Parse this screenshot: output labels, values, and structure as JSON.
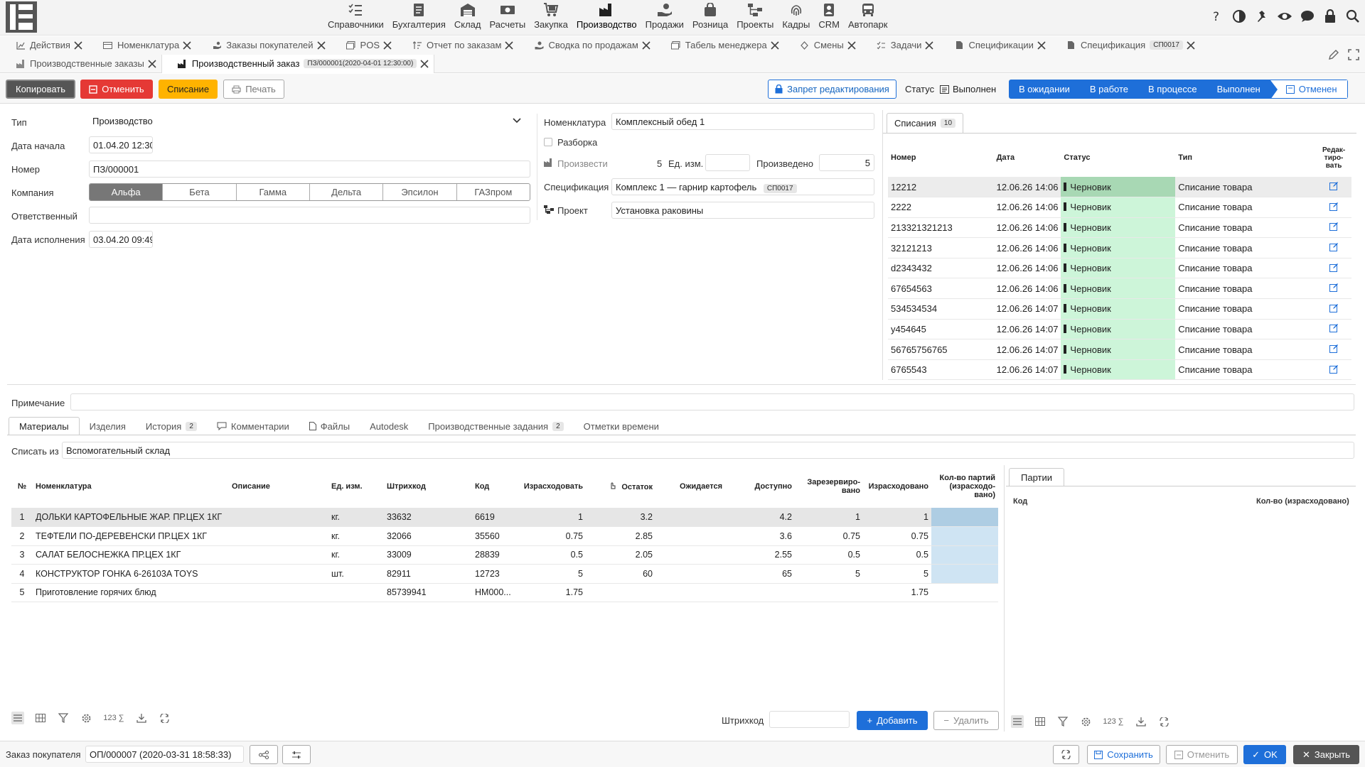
{
  "nav": {
    "modules": [
      {
        "label": "Справочники",
        "icon": "list-icon"
      },
      {
        "label": "Бухгалтерия",
        "icon": "ledger-icon"
      },
      {
        "label": "Склад",
        "icon": "warehouse-icon"
      },
      {
        "label": "Расчеты",
        "icon": "money-icon"
      },
      {
        "label": "Закупка",
        "icon": "cart-icon"
      },
      {
        "label": "Производство",
        "icon": "factory-icon"
      },
      {
        "label": "Продажи",
        "icon": "hand-coin-icon"
      },
      {
        "label": "Розница",
        "icon": "bag-icon"
      },
      {
        "label": "Проекты",
        "icon": "sitemap-icon"
      },
      {
        "label": "Кадры",
        "icon": "fingerprint-icon"
      },
      {
        "label": "CRM",
        "icon": "contact-icon"
      },
      {
        "label": "Автопарк",
        "icon": "bus-icon"
      }
    ]
  },
  "tabs": {
    "row1": [
      {
        "label": "Действия"
      },
      {
        "label": "Номенклатура"
      },
      {
        "label": "Заказы покупателей"
      },
      {
        "label": "POS"
      },
      {
        "label": "Отчет по заказам"
      },
      {
        "label": "Сводка по продажам"
      },
      {
        "label": "Табель менеджера"
      },
      {
        "label": "Смены"
      },
      {
        "label": "Задачи"
      },
      {
        "label": "Спецификации"
      },
      {
        "label": "Спецификация",
        "badge": "СП0017"
      }
    ],
    "row2": [
      {
        "label": "Производственные заказы"
      },
      {
        "label": "Производственный заказ",
        "badge": "ПЗ/000001(2020-04-01 12:30:00)"
      }
    ]
  },
  "toolbar": {
    "copy": "Копировать",
    "cancel": "Отменить",
    "writeoff": "Списание",
    "print": "Печать",
    "lock": "Запрет редактирования",
    "status_label": "Статус",
    "status_value": "Выполнен",
    "steps": [
      "В ожидании",
      "В работе",
      "В процессе",
      "Выполнен",
      "Отменен"
    ]
  },
  "form": {
    "type_label": "Тип",
    "type_value": "Производство",
    "start_label": "Дата начала",
    "start_value": "01.04.20 12:30",
    "number_label": "Номер",
    "number_value": "ПЗ/000001",
    "company_label": "Компания",
    "companies": [
      "Альфа",
      "Бета",
      "Гамма",
      "Дельта",
      "Эпсилон",
      "ГАЗпром"
    ],
    "responsible_label": "Ответственный",
    "responsible_value": "",
    "exec_label": "Дата исполнения",
    "exec_value": "03.04.20 09:49",
    "nomen_label": "Номенклатура",
    "nomen_value": "Комплексный обед 1",
    "disassembly_label": "Разборка",
    "produce_label": "Произвести",
    "produce_qty": "5",
    "unit_label": "Ед. изм.",
    "unit_value": "",
    "produced_label": "Произведено",
    "produced_value": "5",
    "spec_label": "Спецификация",
    "spec_value": "Комплекс 1 — гарнир картофель",
    "spec_badge": "СП0017",
    "project_label": "Проект",
    "project_value": "Установка раковины",
    "note_label": "Примечание",
    "note_value": ""
  },
  "writeoffs": {
    "tab_label": "Списания",
    "count": "10",
    "headers": [
      "Номер",
      "Дата",
      "Статус",
      "Тип",
      "Редак-тиро-вать"
    ],
    "rows": [
      {
        "num": "12212",
        "date": "12.06.26 14:06",
        "status": "Черновик",
        "type": "Списание товара"
      },
      {
        "num": "2222",
        "date": "12.06.26 14:06",
        "status": "Черновик",
        "type": "Списание товара"
      },
      {
        "num": "213321321213",
        "date": "12.06.26 14:06",
        "status": "Черновик",
        "type": "Списание товара"
      },
      {
        "num": "32121213",
        "date": "12.06.26 14:06",
        "status": "Черновик",
        "type": "Списание товара"
      },
      {
        "num": "d2343432",
        "date": "12.06.26 14:06",
        "status": "Черновик",
        "type": "Списание товара"
      },
      {
        "num": "67654563",
        "date": "12.06.26 14:06",
        "status": "Черновик",
        "type": "Списание товара"
      },
      {
        "num": "534534534",
        "date": "12.06.26 14:07",
        "status": "Черновик",
        "type": "Списание товара"
      },
      {
        "num": "y454645",
        "date": "12.06.26 14:07",
        "status": "Черновик",
        "type": "Списание товара"
      },
      {
        "num": "56765756765",
        "date": "12.06.26 14:07",
        "status": "Черновик",
        "type": "Списание товара"
      },
      {
        "num": "6765543",
        "date": "12.06.26 14:07",
        "status": "Черновик",
        "type": "Списание товара"
      }
    ]
  },
  "bottom_tabs": [
    {
      "label": "Материалы"
    },
    {
      "label": "Изделия"
    },
    {
      "label": "История",
      "badge": "2"
    },
    {
      "label": "Комментарии"
    },
    {
      "label": "Файлы"
    },
    {
      "label": "Autodesk"
    },
    {
      "label": "Производственные задания",
      "badge": "2"
    },
    {
      "label": "Отметки времени"
    }
  ],
  "materials": {
    "source_label": "Списать из",
    "source_value": "Вспомогательный склад",
    "headers": [
      "№",
      "Номенклатура",
      "Описание",
      "Ед. изм.",
      "Штрихкод",
      "Код",
      "Израсходовать",
      "Остаток",
      "Ожидается",
      "Доступно",
      "Зарезервиро-вано",
      "Израсходовано",
      "Кол-во партий (израсходо-вано)"
    ],
    "rows": [
      {
        "n": "1",
        "name": "ДОЛЬКИ КАРТОФЕЛЬНЫЕ ЖАР. ПР.ЦЕХ 1КГ",
        "desc": "",
        "unit": "кг.",
        "barcode": "33632",
        "code": "6619",
        "use": "1",
        "rest": "3.2",
        "expected": "",
        "avail": "4.2",
        "reserved": "1",
        "used": "1"
      },
      {
        "n": "2",
        "name": "ТЕФТЕЛИ ПО-ДЕРЕВЕНСКИ ПР.ЦЕХ 1КГ",
        "desc": "",
        "unit": "кг.",
        "barcode": "32066",
        "code": "35560",
        "use": "0.75",
        "rest": "2.85",
        "expected": "",
        "avail": "3.6",
        "reserved": "0.75",
        "used": "0.75"
      },
      {
        "n": "3",
        "name": "САЛАТ БЕЛОСНЕЖКА ПР.ЦЕХ 1КГ",
        "desc": "",
        "unit": "кг.",
        "barcode": "33009",
        "code": "28839",
        "use": "0.5",
        "rest": "2.05",
        "expected": "",
        "avail": "2.55",
        "reserved": "0.5",
        "used": "0.5"
      },
      {
        "n": "4",
        "name": "КОНСТРУКТОР ГОНКА 6-26103A TOYS",
        "desc": "",
        "unit": "шт.",
        "barcode": "82911",
        "code": "12723",
        "use": "5",
        "rest": "60",
        "expected": "",
        "avail": "65",
        "reserved": "5",
        "used": "5"
      },
      {
        "n": "5",
        "name": "Приготовление горячих блюд",
        "desc": "",
        "unit": "",
        "barcode": "85739941",
        "code": "НМ000...",
        "use": "1.75",
        "rest": "",
        "expected": "",
        "avail": "",
        "reserved": "",
        "used": "1.75"
      }
    ],
    "barcode_label": "Штрихкод",
    "add": "Добавить",
    "delete": "Удалить"
  },
  "batches": {
    "tab_label": "Партии",
    "col_code": "Код",
    "col_qty": "Кол-во (израсходовано)"
  },
  "footer": {
    "customer_order_label": "Заказ покупателя",
    "customer_order_value": "ОП/000007 (2020-03-31 18:58:33)",
    "save": "Сохранить",
    "cancel": "Отменить",
    "ok": "OK",
    "close": "Закрыть"
  }
}
